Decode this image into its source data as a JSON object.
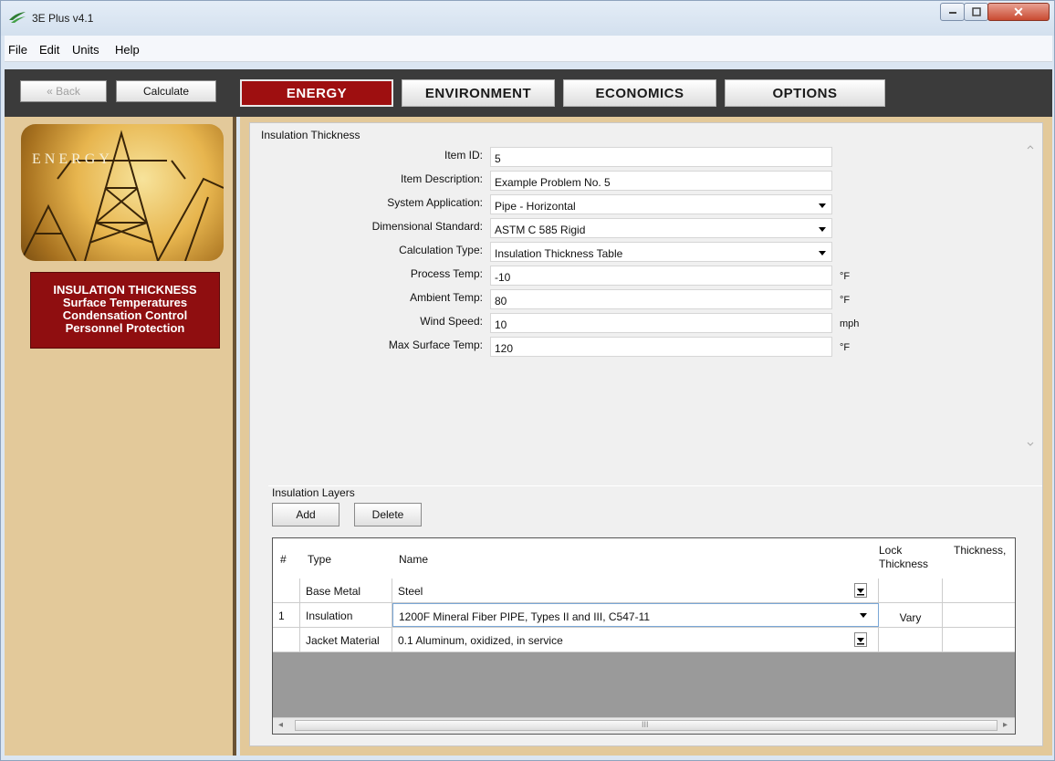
{
  "window": {
    "title": "3E Plus v4.1"
  },
  "menu": [
    "File",
    "Edit",
    "Units",
    "Help"
  ],
  "toolbar": {
    "back": "« Back",
    "calculate": "Calculate"
  },
  "tabs": [
    {
      "label": "ENERGY",
      "active": true
    },
    {
      "label": "ENVIRONMENT",
      "active": false
    },
    {
      "label": "ECONOMICS",
      "active": false
    },
    {
      "label": "OPTIONS",
      "active": false
    }
  ],
  "sidebar": {
    "banner_text": "ENERGY",
    "nav": [
      "INSULATION THICKNESS",
      "Surface Temperatures",
      "Condensation Control",
      "Personnel Protection"
    ]
  },
  "form": {
    "section_title": "Insulation Thickness",
    "fields": [
      {
        "label": "Item ID:",
        "value": "5",
        "unit": ""
      },
      {
        "label": "Item Description:",
        "value": "Example Problem No. 5",
        "unit": ""
      },
      {
        "label": "System Application:",
        "value": "Pipe - Horizontal",
        "unit": "",
        "dropdown": true
      },
      {
        "label": "Dimensional Standard:",
        "value": "ASTM C 585 Rigid",
        "unit": "",
        "dropdown": true
      },
      {
        "label": "Calculation Type:",
        "value": "Insulation Thickness Table",
        "unit": "",
        "dropdown": true
      },
      {
        "label": "Process Temp:",
        "value": "-10",
        "unit": "°F"
      },
      {
        "label": "Ambient Temp:",
        "value": "80",
        "unit": "°F"
      },
      {
        "label": "Wind Speed:",
        "value": "10",
        "unit": "mph"
      },
      {
        "label": "Max Surface Temp:",
        "value": "120",
        "unit": "°F"
      }
    ]
  },
  "layers": {
    "section_title": "Insulation Layers",
    "add": "Add",
    "delete": "Delete",
    "columns": [
      "#",
      "Type",
      "Name",
      "Lock Thickness",
      "Thickness,"
    ],
    "rows": [
      {
        "num": "",
        "type": "Base Metal",
        "name": "Steel",
        "lock": ""
      },
      {
        "num": "1",
        "type": "Insulation",
        "name": "1200F Mineral Fiber PIPE, Types II and III, C547-11",
        "lock": "Vary"
      },
      {
        "num": "",
        "type": "Jacket Material",
        "name": "0.1 Aluminum, oxidized, in service",
        "lock": ""
      }
    ],
    "scroll_grip": "III"
  }
}
